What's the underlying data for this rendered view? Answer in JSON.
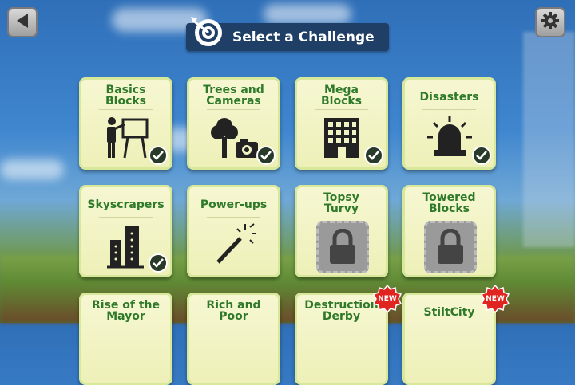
{
  "header": {
    "title": "Select a Challenge",
    "back_icon": "back-arrow-icon",
    "settings_icon": "gear-icon"
  },
  "challenges": [
    {
      "title": "Basics\nBlocks",
      "status": "completed",
      "icon": "teacher-board-icon"
    },
    {
      "title": "Trees and\nCameras",
      "status": "completed",
      "icon": "tree-camera-icon"
    },
    {
      "title": "Mega\nBlocks",
      "status": "completed",
      "icon": "building-icon"
    },
    {
      "title": "Disasters",
      "status": "completed",
      "icon": "siren-icon"
    },
    {
      "title": "Skyscrapers",
      "status": "completed",
      "icon": "skyscraper-icon"
    },
    {
      "title": "Power-ups",
      "status": "available",
      "icon": "magic-wand-icon"
    },
    {
      "title": "Topsy\nTurvy",
      "status": "locked",
      "icon": "lock-icon"
    },
    {
      "title": "Towered\nBlocks",
      "status": "locked",
      "icon": "lock-icon"
    },
    {
      "title": "Rise of the\nMayor",
      "status": "partial"
    },
    {
      "title": "Rich and\nPoor",
      "status": "partial"
    },
    {
      "title": "Destruction\nDerby",
      "status": "partial",
      "badge": "NEW"
    },
    {
      "title": "StiltCity",
      "status": "partial",
      "badge": "NEW"
    }
  ],
  "colors": {
    "title_bar": "#1f3f66",
    "card_title": "#2f7a2a",
    "card_bg": "#f6f7d2",
    "badge": "#e0241f"
  }
}
